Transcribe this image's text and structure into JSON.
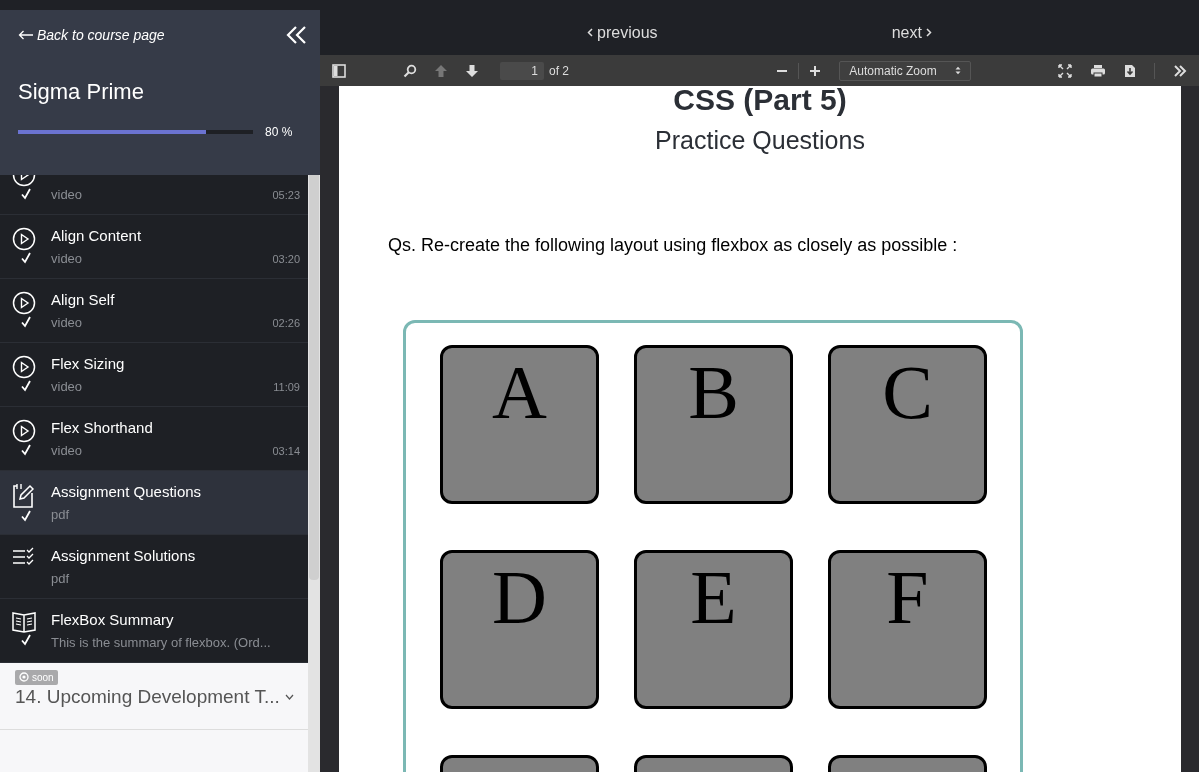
{
  "sidebar": {
    "back_link": "Back to course page",
    "course_title": "Sigma Prime",
    "progress": {
      "level": 0.8,
      "reading": "80 %"
    },
    "items": [
      {
        "kind": "video",
        "type": "video",
        "duration": "05:23",
        "done": true,
        "selected": false
      },
      {
        "kind": "video",
        "title": "Align Content",
        "type": "video",
        "duration": "03:20",
        "done": true,
        "selected": false
      },
      {
        "kind": "video",
        "title": "Align Self",
        "type": "video",
        "duration": "02:26",
        "done": true,
        "selected": false
      },
      {
        "kind": "video",
        "title": "Flex Sizing",
        "type": "video",
        "duration": "11:09",
        "done": true,
        "selected": false
      },
      {
        "kind": "video",
        "title": "Flex Shorthand",
        "type": "video",
        "duration": "03:14",
        "done": true,
        "selected": false
      },
      {
        "kind": "assignment",
        "title": "Assignment Questions",
        "type": "pdf",
        "done": true,
        "selected": true
      },
      {
        "kind": "solutions",
        "title": "Assignment Solutions",
        "type": "pdf",
        "done": false,
        "selected": false
      },
      {
        "kind": "summary",
        "title": "FlexBox Summary",
        "type": "This is the summary of flexbox. (Ord...",
        "done": true,
        "selected": false
      }
    ],
    "section": {
      "badge": "soon",
      "title": "14. Upcoming Development T...",
      "expanded": false
    }
  },
  "nav": {
    "previous": "previous",
    "next": "next"
  },
  "pdf_toolbar": {
    "page": "1",
    "page_count": "of 2",
    "zoom": "Automatic Zoom"
  },
  "document": {
    "title": "CSS (Part 5)",
    "subtitle": "Practice Questions",
    "question": "Qs. Re-create the following layout using flexbox as closely as possible :",
    "boxes": [
      "A",
      "B",
      "C",
      "D",
      "E",
      "F"
    ]
  }
}
